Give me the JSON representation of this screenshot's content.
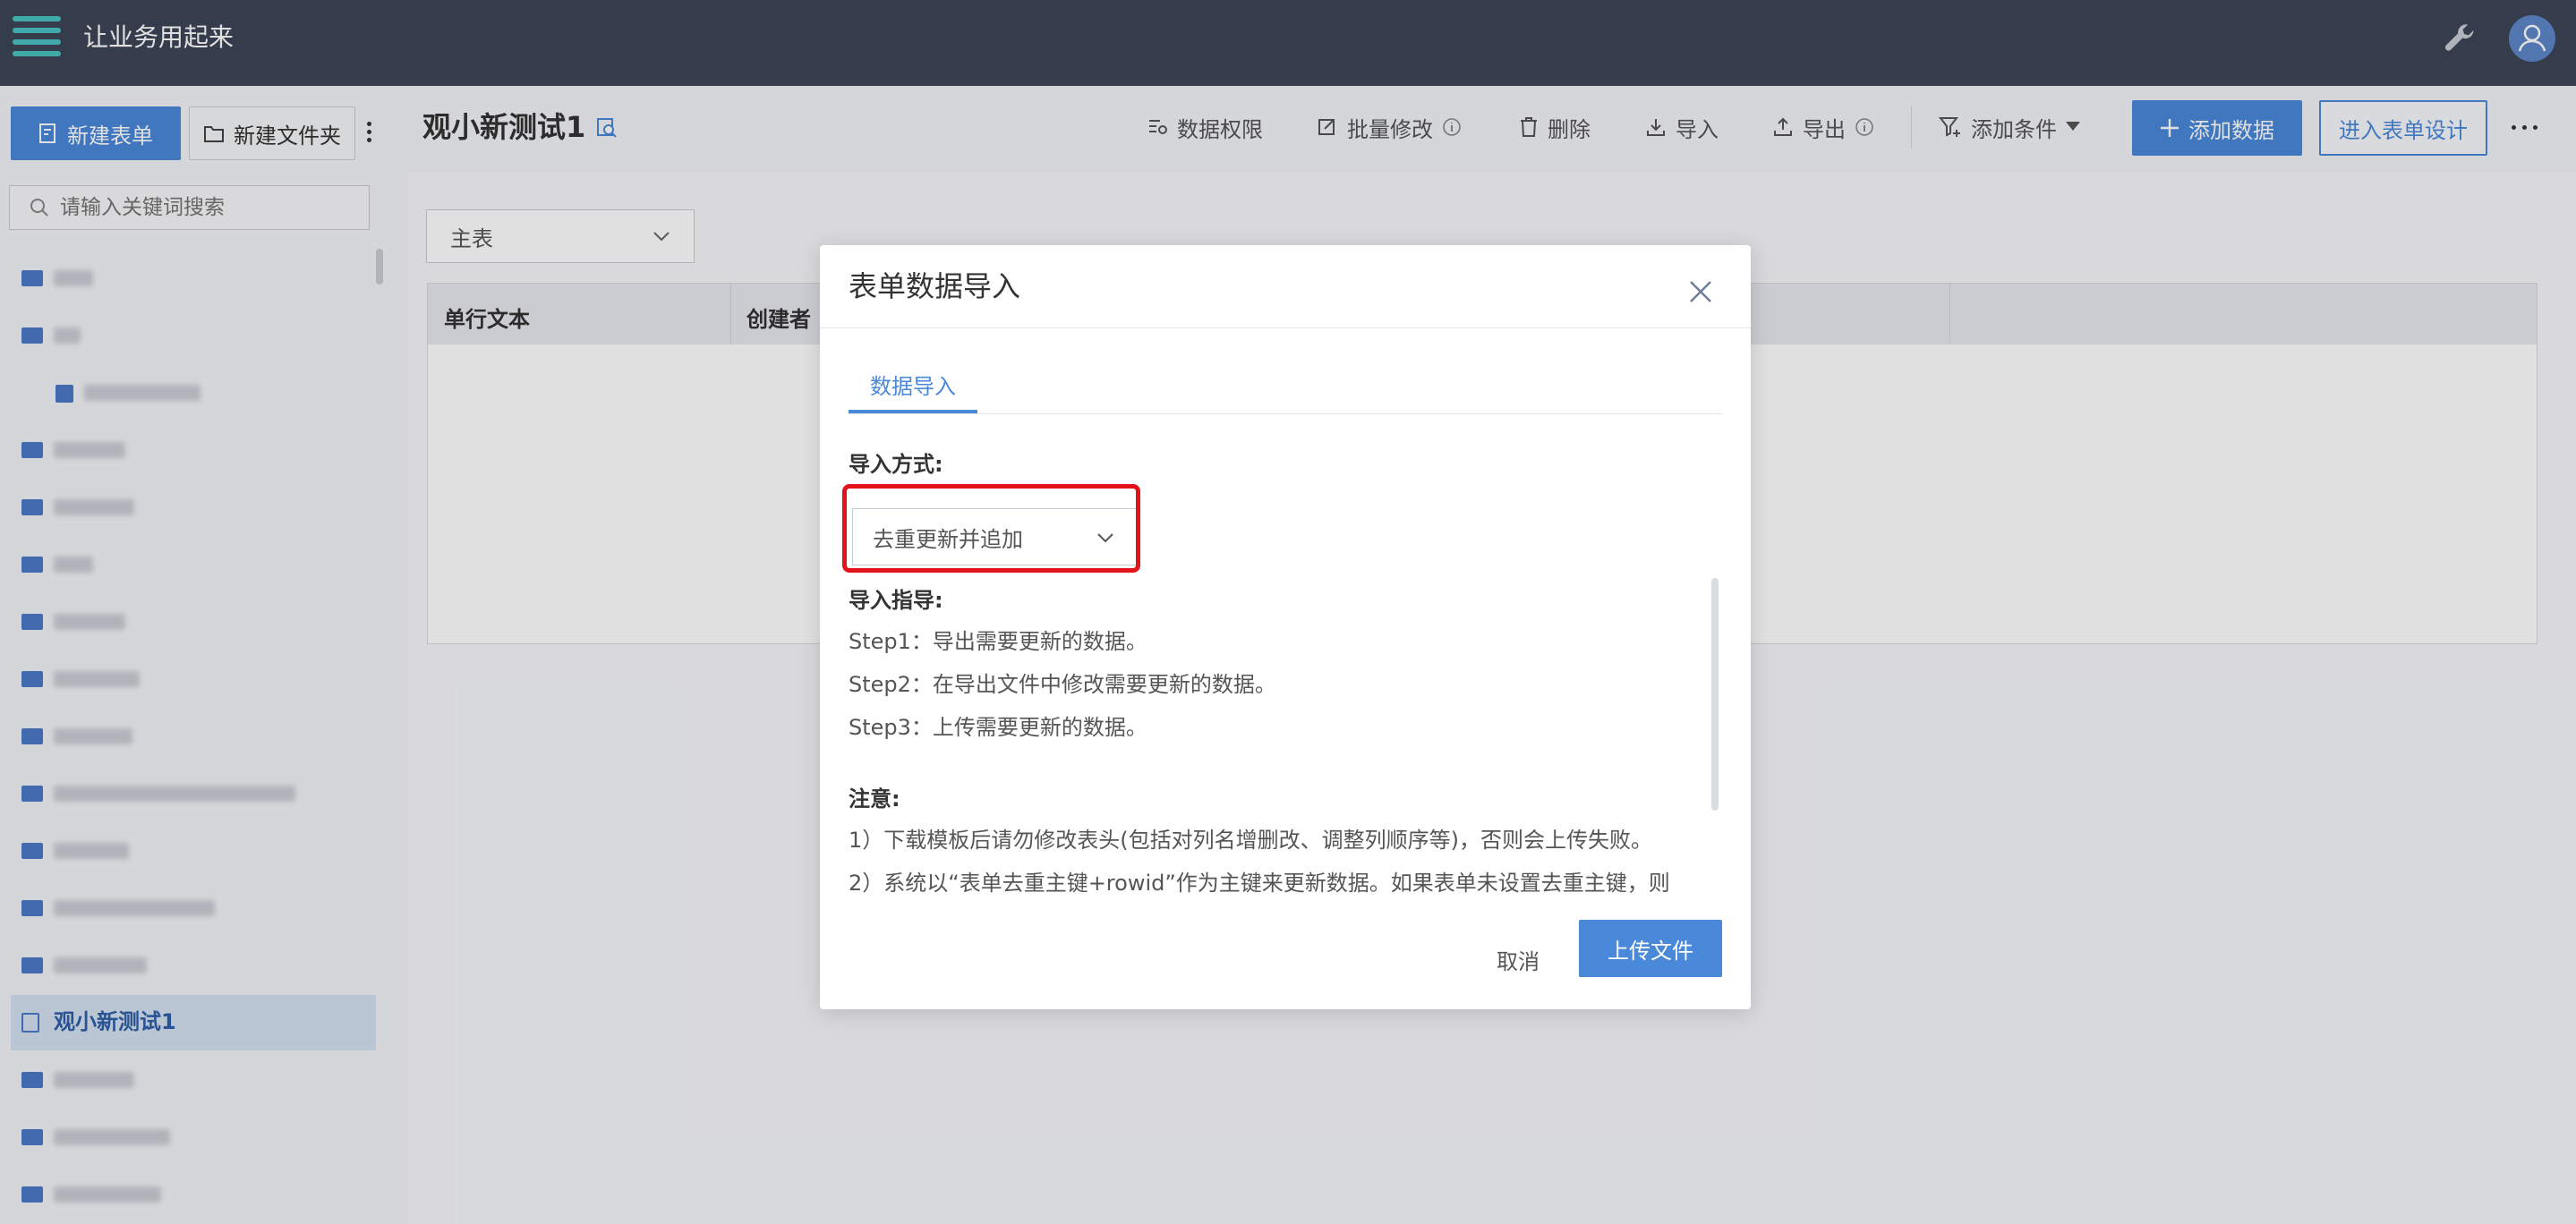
{
  "app": {
    "title": "让业务用起来"
  },
  "sidebar": {
    "new_form_label": "新建表单",
    "new_folder_label": "新建文件夹",
    "search_placeholder": "请输入关键词搜索",
    "active_item_label": "观小新测试1"
  },
  "header": {
    "page_title": "观小新测试1",
    "toolbar": {
      "permissions_label": "数据权限",
      "batch_edit_label": "批量修改",
      "delete_label": "删除",
      "import_label": "导入",
      "export_label": "导出",
      "add_condition_label": "添加条件",
      "add_data_label": "添加数据",
      "design_label": "进入表单设计"
    }
  },
  "content": {
    "sheet_select_value": "主表",
    "columns": [
      "单行文本",
      "创建者"
    ]
  },
  "dialog": {
    "title": "表单数据导入",
    "tab_label": "数据导入",
    "method_label": "导入方式:",
    "method_value": "去重更新并追加",
    "guide_title": "导入指导:",
    "guide_steps": [
      "Step1：导出需要更新的数据。",
      "Step2：在导出文件中修改需要更新的数据。",
      "Step3：上传需要更新的数据。"
    ],
    "note_title": "注意:",
    "notes": [
      "1）下载模板后请勿修改表头(包括对列名增删改、调整列顺序等)，否则会上传失败。",
      "2）系统以“表单去重主键+rowid”作为主键来更新数据。如果表单未设置去重主键，则"
    ],
    "cancel_label": "取消",
    "upload_label": "上传文件"
  },
  "colors": {
    "accent": "#4a88d9",
    "topbar": "#3d4557",
    "highlight": "#e3131b"
  }
}
